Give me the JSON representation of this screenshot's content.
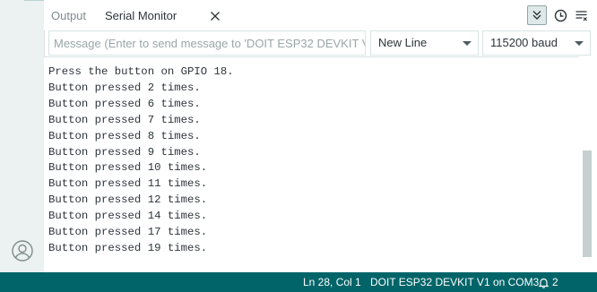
{
  "tabs": {
    "output_label": "Output",
    "serial_label": "Serial Monitor"
  },
  "toolbar": {
    "autoscroll_icon": "double-chevron-down-icon",
    "timestamp_icon": "clock-icon",
    "clear_icon": "clear-output-icon"
  },
  "input": {
    "placeholder": "Message (Enter to send message to 'DOIT ESP32 DEVKIT V...",
    "value": ""
  },
  "selects": {
    "line_ending": "New Line",
    "baud_rate": "115200 baud"
  },
  "output_lines": [
    "Press the button on GPIO 18.",
    "Button pressed 2 times.",
    "Button pressed 6 times.",
    "Button pressed 7 times.",
    "Button pressed 8 times.",
    "Button pressed 9 times.",
    "Button pressed 10 times.",
    "Button pressed 11 times.",
    "Button pressed 12 times.",
    "Button pressed 14 times.",
    "Button pressed 17 times.",
    "Button pressed 19 times."
  ],
  "status": {
    "cursor_position": "Ln 28, Col 1",
    "board": "DOIT ESP32 DEVKIT V1 on COM3",
    "notifications": "2"
  },
  "colors": {
    "status_bar": "#006468",
    "sidebar": "#ecf1f1"
  }
}
